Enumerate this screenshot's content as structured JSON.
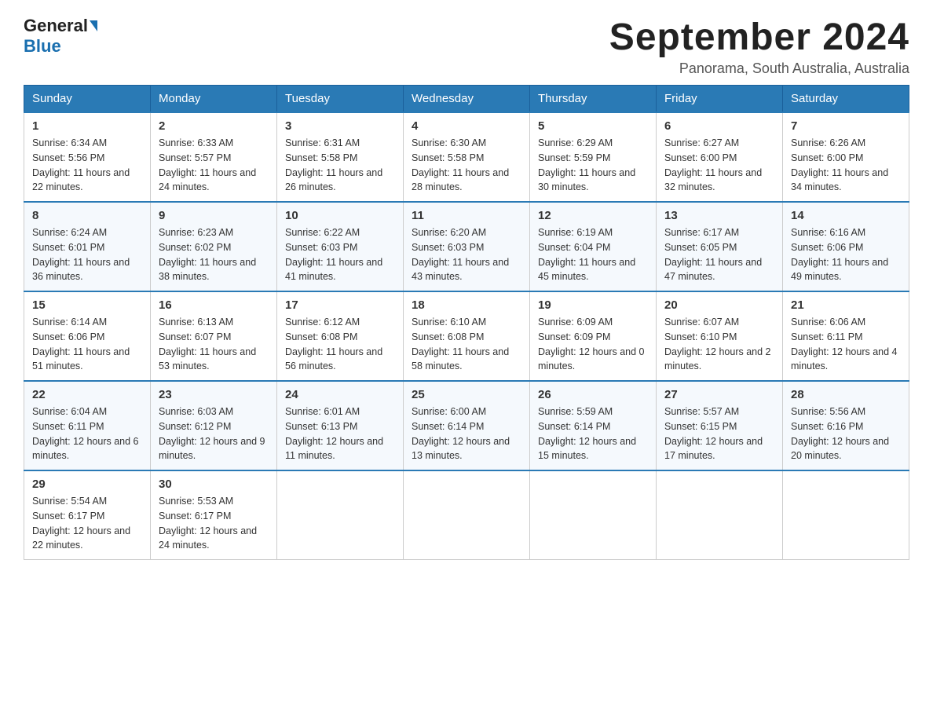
{
  "header": {
    "logo_general": "General",
    "logo_blue": "Blue",
    "month_title": "September 2024",
    "location": "Panorama, South Australia, Australia"
  },
  "weekdays": [
    "Sunday",
    "Monday",
    "Tuesday",
    "Wednesday",
    "Thursday",
    "Friday",
    "Saturday"
  ],
  "weeks": [
    [
      {
        "day": "1",
        "sunrise": "6:34 AM",
        "sunset": "5:56 PM",
        "daylight": "11 hours and 22 minutes."
      },
      {
        "day": "2",
        "sunrise": "6:33 AM",
        "sunset": "5:57 PM",
        "daylight": "11 hours and 24 minutes."
      },
      {
        "day": "3",
        "sunrise": "6:31 AM",
        "sunset": "5:58 PM",
        "daylight": "11 hours and 26 minutes."
      },
      {
        "day": "4",
        "sunrise": "6:30 AM",
        "sunset": "5:58 PM",
        "daylight": "11 hours and 28 minutes."
      },
      {
        "day": "5",
        "sunrise": "6:29 AM",
        "sunset": "5:59 PM",
        "daylight": "11 hours and 30 minutes."
      },
      {
        "day": "6",
        "sunrise": "6:27 AM",
        "sunset": "6:00 PM",
        "daylight": "11 hours and 32 minutes."
      },
      {
        "day": "7",
        "sunrise": "6:26 AM",
        "sunset": "6:00 PM",
        "daylight": "11 hours and 34 minutes."
      }
    ],
    [
      {
        "day": "8",
        "sunrise": "6:24 AM",
        "sunset": "6:01 PM",
        "daylight": "11 hours and 36 minutes."
      },
      {
        "day": "9",
        "sunrise": "6:23 AM",
        "sunset": "6:02 PM",
        "daylight": "11 hours and 38 minutes."
      },
      {
        "day": "10",
        "sunrise": "6:22 AM",
        "sunset": "6:03 PM",
        "daylight": "11 hours and 41 minutes."
      },
      {
        "day": "11",
        "sunrise": "6:20 AM",
        "sunset": "6:03 PM",
        "daylight": "11 hours and 43 minutes."
      },
      {
        "day": "12",
        "sunrise": "6:19 AM",
        "sunset": "6:04 PM",
        "daylight": "11 hours and 45 minutes."
      },
      {
        "day": "13",
        "sunrise": "6:17 AM",
        "sunset": "6:05 PM",
        "daylight": "11 hours and 47 minutes."
      },
      {
        "day": "14",
        "sunrise": "6:16 AM",
        "sunset": "6:06 PM",
        "daylight": "11 hours and 49 minutes."
      }
    ],
    [
      {
        "day": "15",
        "sunrise": "6:14 AM",
        "sunset": "6:06 PM",
        "daylight": "11 hours and 51 minutes."
      },
      {
        "day": "16",
        "sunrise": "6:13 AM",
        "sunset": "6:07 PM",
        "daylight": "11 hours and 53 minutes."
      },
      {
        "day": "17",
        "sunrise": "6:12 AM",
        "sunset": "6:08 PM",
        "daylight": "11 hours and 56 minutes."
      },
      {
        "day": "18",
        "sunrise": "6:10 AM",
        "sunset": "6:08 PM",
        "daylight": "11 hours and 58 minutes."
      },
      {
        "day": "19",
        "sunrise": "6:09 AM",
        "sunset": "6:09 PM",
        "daylight": "12 hours and 0 minutes."
      },
      {
        "day": "20",
        "sunrise": "6:07 AM",
        "sunset": "6:10 PM",
        "daylight": "12 hours and 2 minutes."
      },
      {
        "day": "21",
        "sunrise": "6:06 AM",
        "sunset": "6:11 PM",
        "daylight": "12 hours and 4 minutes."
      }
    ],
    [
      {
        "day": "22",
        "sunrise": "6:04 AM",
        "sunset": "6:11 PM",
        "daylight": "12 hours and 6 minutes."
      },
      {
        "day": "23",
        "sunrise": "6:03 AM",
        "sunset": "6:12 PM",
        "daylight": "12 hours and 9 minutes."
      },
      {
        "day": "24",
        "sunrise": "6:01 AM",
        "sunset": "6:13 PM",
        "daylight": "12 hours and 11 minutes."
      },
      {
        "day": "25",
        "sunrise": "6:00 AM",
        "sunset": "6:14 PM",
        "daylight": "12 hours and 13 minutes."
      },
      {
        "day": "26",
        "sunrise": "5:59 AM",
        "sunset": "6:14 PM",
        "daylight": "12 hours and 15 minutes."
      },
      {
        "day": "27",
        "sunrise": "5:57 AM",
        "sunset": "6:15 PM",
        "daylight": "12 hours and 17 minutes."
      },
      {
        "day": "28",
        "sunrise": "5:56 AM",
        "sunset": "6:16 PM",
        "daylight": "12 hours and 20 minutes."
      }
    ],
    [
      {
        "day": "29",
        "sunrise": "5:54 AM",
        "sunset": "6:17 PM",
        "daylight": "12 hours and 22 minutes."
      },
      {
        "day": "30",
        "sunrise": "5:53 AM",
        "sunset": "6:17 PM",
        "daylight": "12 hours and 24 minutes."
      },
      null,
      null,
      null,
      null,
      null
    ]
  ],
  "labels": {
    "sunrise_prefix": "Sunrise: ",
    "sunset_prefix": "Sunset: ",
    "daylight_prefix": "Daylight: "
  }
}
